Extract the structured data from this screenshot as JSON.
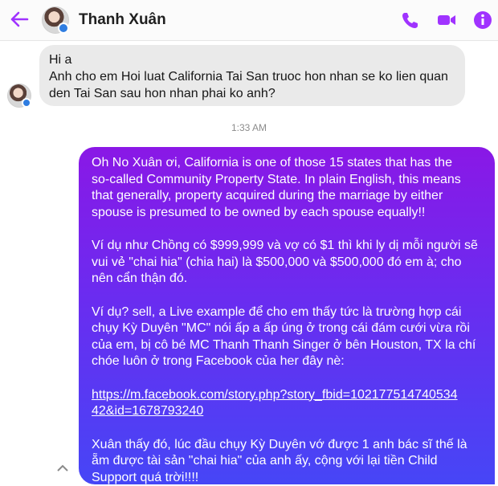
{
  "header": {
    "contact_name": "Thanh Xuân",
    "back_icon": "arrow-left-icon",
    "call_icon": "phone-icon",
    "video_icon": "video-camera-icon",
    "info_icon": "info-icon",
    "accent_color": "#a033ff"
  },
  "incoming_message": {
    "lines": [
      "Hi a",
      "Anh cho em Hoi luat California Tai San truoc hon nhan se ko lien quan",
      "den Tai San sau hon nhan phai ko anh?"
    ]
  },
  "timestamp": "1:33 AM",
  "outgoing_message": {
    "gradient": [
      "#8a18e6",
      "#4646f6"
    ],
    "paragraph1": [
      "Oh No Xuân ơi, California is one of those 15 states that has the",
      "so-called Community Property State. In plain English, this means",
      "that generally, property acquired during the marriage by either",
      "spouse is presumed to be owned by each spouse equally!!"
    ],
    "paragraph2": [
      "Ví dụ như Chồng có $999,999 và vợ có $1 thì khi ly dị mỗi người sẽ",
      "vui vẻ \"chai hia\" (chia hai) là $500,000 và $500,000 đó em à; cho",
      "nên cẩn thận đó."
    ],
    "paragraph3": [
      "Ví dụ? sell, a Live example để cho em thấy tức là trường hợp cái",
      "chụy Kỳ Duyên \"MC\" nói ấp a ấp úng ở trong cái đám cưới vừa rồi",
      "của em, bị cô bé MC Thanh Thanh Singer ở bên Houston, TX la chí",
      "chóe luôn ở trong Facebook của her đây nè:"
    ],
    "link_lines": [
      "https://m.facebook.com/story.php?story_fbid=102177514740534",
      "42&id=1678793240"
    ],
    "paragraph4": [
      "Xuân thấy đó, lúc đầu chụy Kỳ Duyên vớ được 1 anh bác sĩ thế là",
      "ẵm được tài sản \"chai hia\" của anh ấy, cộng với lại tiền Child",
      "Support quá trời!!!!"
    ]
  }
}
